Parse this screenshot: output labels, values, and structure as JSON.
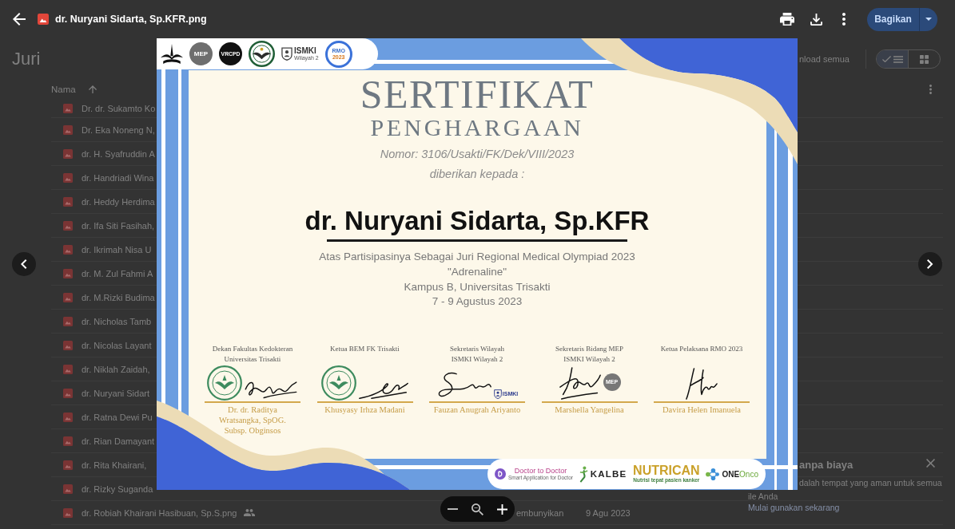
{
  "viewer": {
    "title": "dr. Nuryani Sidarta, Sp.KFR.png",
    "share_button": "Bagikan"
  },
  "drive_page": {
    "folder_title": "Juri",
    "toolbar_button": "nload semua",
    "view_modes": [
      {
        "kind": "list",
        "selected": true
      },
      {
        "kind": "grid",
        "selected": false
      }
    ],
    "name_column": "Nama",
    "files": [
      {
        "name": "Dr. dr. Sukamto Ko",
        "shared": false
      },
      {
        "name": "Dr. Eka Noneng N,",
        "shared": false
      },
      {
        "name": "dr. H. Syafruddin A",
        "shared": false
      },
      {
        "name": "dr. Handriadi Wina",
        "shared": false
      },
      {
        "name": "dr. Heddy Herdima",
        "shared": false
      },
      {
        "name": "dr. Ifa Siti Fasihah,",
        "shared": false
      },
      {
        "name": "dr. Ikrimah Nisa U",
        "shared": false
      },
      {
        "name": "dr. M. Zul Fahmi A",
        "shared": false
      },
      {
        "name": "dr. M.Rizki Budima",
        "shared": false
      },
      {
        "name": "dr. Nicholas Tamb",
        "shared": false
      },
      {
        "name": "dr. Nicolas Layant",
        "shared": false
      },
      {
        "name": "dr. Niklah Zaidah,",
        "shared": false
      },
      {
        "name": "dr. Nuryani Sidart",
        "shared": false
      },
      {
        "name": "dr. Ratna Dewi Pu",
        "shared": false
      },
      {
        "name": "dr. Rian Damayant",
        "shared": false
      },
      {
        "name": "dr. Rita Khairani,",
        "shared": false
      },
      {
        "name": "dr. Rizky Suganda",
        "shared": false
      },
      {
        "name": "dr. Robiah Khairani Hasibuan, Sp.S.png",
        "shared": true,
        "column_2": "embunyikan",
        "column_3": "9 Agu 2023"
      }
    ],
    "promo": {
      "title": "anpa biaya",
      "lines": [
        "dalah tempat yang aman untuk semua",
        "ile Anda"
      ],
      "link": "Mulai gunakan sekarang"
    }
  },
  "certificate": {
    "top_logos": [
      {
        "kind": "emblem"
      },
      {
        "kind": "disc",
        "text": "MEP",
        "color": "#6e6e6e"
      },
      {
        "kind": "disc",
        "text": "VRCPD",
        "color": "#111111"
      },
      {
        "kind": "seal"
      },
      {
        "kind": "wordmark",
        "text": "ISMKI",
        "subtext": "Wilayah 2"
      },
      {
        "kind": "ring",
        "text": "RMO",
        "subtext": "2023"
      }
    ],
    "title": "SERTIFIKAT",
    "subtitle": "PENGHARGAAN",
    "number": "Nomor: 3106/Usakti/FK/Dek/VIII/2023",
    "given_to": "diberikan kepada :",
    "recipient": "dr. Nuryani Sidarta, Sp.KFR",
    "details": [
      "Atas Partisipasinya Sebagai Juri Regional Medical Olympiad 2023",
      "\"Adrenaline\"",
      "Kampus B, Universitas Trisakti",
      "7 - 9 Agustus 2023"
    ],
    "signatories": [
      {
        "role": [
          "Dekan Fakultas Kedokteran",
          "Universitas Trisakti"
        ],
        "name": "Dr. dr. Raditya Wratsangka, SpOG. Subsp. Obginsos",
        "stamp": {
          "kind": "seal"
        }
      },
      {
        "role": [
          "Ketua BEM FK Trisakti"
        ],
        "name": "Khusyasy Irhza Madani",
        "stamp": {
          "kind": "seal"
        }
      },
      {
        "role": [
          "Sekretaris Wilayah",
          "ISMKI Wilayah 2"
        ],
        "name": "Fauzan Anugrah Ariyanto",
        "stamp": {
          "kind": "badge",
          "text": "ISMKI"
        }
      },
      {
        "role": [
          "Sekretaris Bidang MEP",
          "ISMKI Wilayah 2"
        ],
        "name": "Marshella Yangelina",
        "stamp": {
          "kind": "disc",
          "text": "MEP"
        }
      },
      {
        "role": [
          "Ketua Pelaksana RMO 2023"
        ],
        "name": "Davira Helen Imanuela"
      }
    ],
    "sponsor_logos": [
      {
        "kind": "app",
        "text": "Doctor to Doctor",
        "subtext": "Smart Application for Doctor"
      },
      {
        "kind": "figure",
        "text": "KALBE"
      },
      {
        "kind": "plain",
        "text": "NUTRICAN",
        "subtext": "Nutrisi tepat pasien kanker"
      },
      {
        "kind": "dots",
        "text": "**ONE**Onco"
      }
    ]
  }
}
